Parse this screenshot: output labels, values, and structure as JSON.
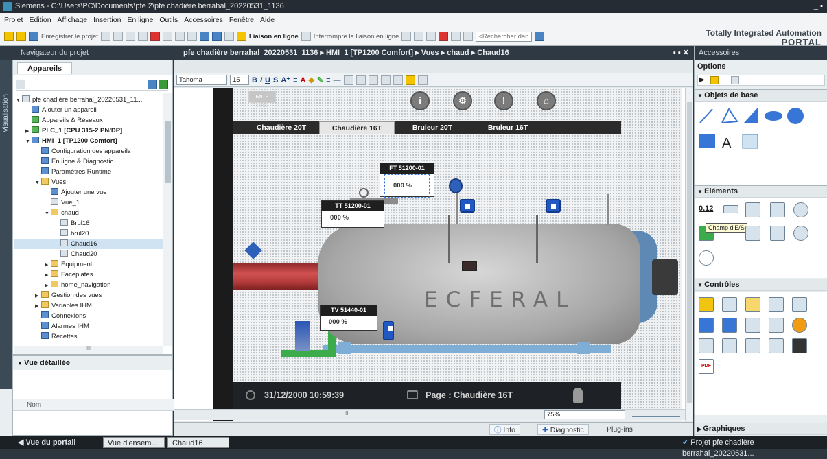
{
  "window": {
    "title": "Siemens - C:\\Users\\PC\\Documents\\pfe 2\\pfe chadière berrahal_20220531_1136",
    "controls": "_ ▪"
  },
  "menu": {
    "items": [
      "Projet",
      "Edition",
      "Affichage",
      "Insertion",
      "En ligne",
      "Outils",
      "Accessoires",
      "Fenêtre",
      "Aide"
    ]
  },
  "toolbar": {
    "save_project": "Enregistrer le projet",
    "go_online": "Liaison en ligne",
    "go_offline": "Interrompre la liaison en ligne",
    "search_placeholder": "<Rechercher dans le"
  },
  "brand": {
    "line1": "Totally Integrated Automation",
    "line2": "PORTAL"
  },
  "left_panel": {
    "header": "Navigateur du projet",
    "vertical_tab": "Visualisation",
    "tab": "Appareils",
    "tree": [
      {
        "label": "pfe chadière berrahal_20220531_11...",
        "indent": 0,
        "icon": "doc",
        "twisty": "▼"
      },
      {
        "label": "Ajouter un appareil",
        "indent": 1,
        "icon": "blue",
        "twisty": ""
      },
      {
        "label": "Appareils & Réseaux",
        "indent": 1,
        "icon": "green",
        "twisty": ""
      },
      {
        "label": "PLC_1 [CPU 315-2 PN/DP]",
        "indent": 1,
        "icon": "green",
        "twisty": "▶",
        "bold": true
      },
      {
        "label": "HMI_1 [TP1200 Comfort]",
        "indent": 1,
        "icon": "blue",
        "twisty": "▼",
        "bold": true
      },
      {
        "label": "Configuration des appareils",
        "indent": 2,
        "icon": "blue",
        "twisty": ""
      },
      {
        "label": "En ligne & Diagnostic",
        "indent": 2,
        "icon": "blue",
        "twisty": ""
      },
      {
        "label": "Paramètres Runtime",
        "indent": 2,
        "icon": "blue",
        "twisty": ""
      },
      {
        "label": "Vues",
        "indent": 2,
        "icon": "folder",
        "twisty": "▼"
      },
      {
        "label": "Ajouter une vue",
        "indent": 3,
        "icon": "blue",
        "twisty": ""
      },
      {
        "label": "Vue_1",
        "indent": 3,
        "icon": "doc",
        "twisty": ""
      },
      {
        "label": "chaud",
        "indent": 3,
        "icon": "folder",
        "twisty": "▼"
      },
      {
        "label": "Brul16",
        "indent": 4,
        "icon": "doc",
        "twisty": ""
      },
      {
        "label": "brul20",
        "indent": 4,
        "icon": "doc",
        "twisty": ""
      },
      {
        "label": "Chaud16",
        "indent": 4,
        "icon": "doc",
        "twisty": "",
        "selected": true
      },
      {
        "label": "Chaud20",
        "indent": 4,
        "icon": "doc",
        "twisty": ""
      },
      {
        "label": "Equipment",
        "indent": 3,
        "icon": "folder",
        "twisty": "▶"
      },
      {
        "label": "Faceplates",
        "indent": 3,
        "icon": "folder",
        "twisty": "▶"
      },
      {
        "label": "home_navigation",
        "indent": 3,
        "icon": "folder",
        "twisty": "▶"
      },
      {
        "label": "Gestion des vues",
        "indent": 2,
        "icon": "folder",
        "twisty": "▶"
      },
      {
        "label": "Variables IHM",
        "indent": 2,
        "icon": "folder",
        "twisty": "▶"
      },
      {
        "label": "Connexions",
        "indent": 2,
        "icon": "blue",
        "twisty": ""
      },
      {
        "label": "Alarmes IHM",
        "indent": 2,
        "icon": "blue",
        "twisty": ""
      },
      {
        "label": "Recettes",
        "indent": 2,
        "icon": "blue",
        "twisty": ""
      }
    ],
    "detail_header": "Vue détaillée",
    "detail_col": "Nom"
  },
  "editor": {
    "breadcrumb": "pfe chadière berrahal_20220531_1136 ▸ HMI_1 [TP1200 Comfort] ▸ Vues ▸ chaud ▸ Chaud16",
    "window_controls": "_ ▪ ▪ ✕",
    "font_name": "Tahoma",
    "font_size": "15",
    "zoom": "75%",
    "scroll_mark": "III"
  },
  "hmi": {
    "logo": "ENTP",
    "logo_sub": "SIRCO",
    "top_buttons": [
      {
        "glyph": "i",
        "label": "Info"
      },
      {
        "glyph": "⚙",
        "label": "Options"
      },
      {
        "glyph": "!",
        "label": "Alarmes"
      },
      {
        "glyph": "⌂",
        "label": "Accueil"
      }
    ],
    "tabs": [
      "Chaudière 20T",
      "Chaudière 16T",
      "Bruleur 20T",
      "Bruleur 16T"
    ],
    "active_tab": 1,
    "tags": [
      {
        "title": "FT 51200-01",
        "value": "000",
        "unit": "%"
      },
      {
        "title": "TT 51200-01",
        "value": "000",
        "unit": "%"
      },
      {
        "title": "TV 51440-01",
        "value": "000",
        "unit": "%"
      }
    ],
    "tank_brand": "ECFERAL",
    "datetime": "31/12/2000 10:59:39",
    "page_label": "Page : Chaudière 16T"
  },
  "right_panel": {
    "header": "Accessoires",
    "options": "Options",
    "sections": [
      "Objets de base",
      "Eléments",
      "Contrôles",
      "Graphiques"
    ],
    "tooltip": "Champ d'E/S",
    "element_field": "0.12"
  },
  "bottom_tabs": [
    "Info",
    "Diagnostic",
    "Plug-ins"
  ],
  "taskbar": {
    "portal_view": "◀  Vue du portail",
    "task1": "Vue d'ensem...",
    "task2": "Chaud16",
    "status": "Projet pfe chadière berrahal_20220531..."
  },
  "colors": {
    "accent": "#2e3943",
    "pipe_red": "#c64545",
    "pipe_green": "#3cab4c",
    "pipe_blue": "#7eaed6",
    "valve_blue": "#2158c4"
  }
}
